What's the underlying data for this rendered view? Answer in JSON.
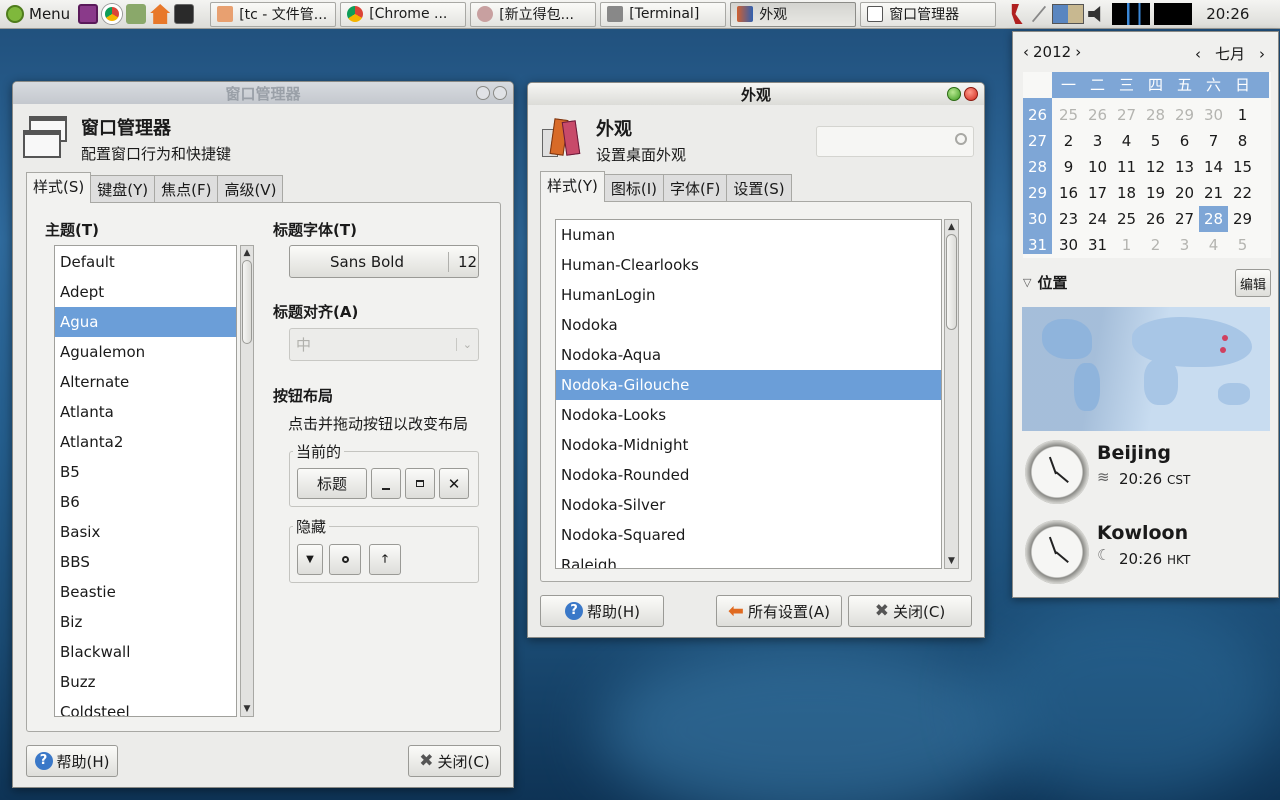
{
  "panel": {
    "menu_label": "Menu",
    "tasks": [
      {
        "label": "[tc - 文件管...",
        "icon": "home-folder-icon"
      },
      {
        "label": "[Chrome ...",
        "icon": "chrome-icon"
      },
      {
        "label": "[新立得包...",
        "icon": "synaptic-icon"
      },
      {
        "label": "[Terminal]",
        "icon": "terminal-icon"
      },
      {
        "label": "外观",
        "icon": "appearance-icon"
      },
      {
        "label": "窗口管理器",
        "icon": "window-manager-icon"
      }
    ],
    "clock": "20:26"
  },
  "wm_window": {
    "title": "窗口管理器",
    "header_title": "窗口管理器",
    "header_subtitle": "配置窗口行为和快捷键",
    "tabs": [
      "样式(S)",
      "键盘(Y)",
      "焦点(F)",
      "高级(V)"
    ],
    "theme_label": "主题(T)",
    "themes": [
      "Default",
      "Adept",
      "Agua",
      "Agualemon",
      "Alternate",
      "Atlanta",
      "Atlanta2",
      "B5",
      "B6",
      "Basix",
      "BBS",
      "Beastie",
      "Biz",
      "Blackwall",
      "Buzz",
      "Coldsteel"
    ],
    "selected_theme": "Agua",
    "title_font_label": "标题字体(T)",
    "title_font_name": "Sans Bold",
    "title_font_size": "12",
    "title_align_label": "标题对齐(A)",
    "title_align_value": "中",
    "button_layout_label": "按钮布局",
    "button_layout_hint": "点击并拖动按钮以改变布局",
    "current_label": "当前的",
    "title_button": "标题",
    "hidden_label": "隐藏",
    "help_button": "帮助(H)",
    "close_button": "关闭(C)"
  },
  "appearance_window": {
    "title": "外观",
    "header_title": "外观",
    "header_subtitle": "设置桌面外观",
    "search_placeholder": "",
    "tabs": [
      "样式(Y)",
      "图标(I)",
      "字体(F)",
      "设置(S)"
    ],
    "styles": [
      "Human",
      "Human-Clearlooks",
      "HumanLogin",
      "Nodoka",
      "Nodoka-Aqua",
      "Nodoka-Gilouche",
      "Nodoka-Looks",
      "Nodoka-Midnight",
      "Nodoka-Rounded",
      "Nodoka-Silver",
      "Nodoka-Squared",
      "Raleigh"
    ],
    "selected_style": "Nodoka-Gilouche",
    "help_button": "帮助(H)",
    "all_settings_button": "所有设置(A)",
    "close_button": "关闭(C)"
  },
  "calendar": {
    "year": "2012",
    "month": "七月",
    "weekdays": [
      "一",
      "二",
      "三",
      "四",
      "五",
      "六",
      "日"
    ],
    "weeks": [
      {
        "num": "26",
        "days": [
          "25",
          "26",
          "27",
          "28",
          "29",
          "30",
          "1"
        ]
      },
      {
        "num": "27",
        "days": [
          "2",
          "3",
          "4",
          "5",
          "6",
          "7",
          "8"
        ]
      },
      {
        "num": "28",
        "days": [
          "9",
          "10",
          "11",
          "12",
          "13",
          "14",
          "15"
        ]
      },
      {
        "num": "29",
        "days": [
          "16",
          "17",
          "18",
          "19",
          "20",
          "21",
          "22"
        ]
      },
      {
        "num": "30",
        "days": [
          "23",
          "24",
          "25",
          "26",
          "27",
          "28",
          "29"
        ]
      },
      {
        "num": "31",
        "days": [
          "30",
          "31",
          "1",
          "2",
          "3",
          "4",
          "5"
        ]
      }
    ],
    "today": "28",
    "locations_label": "位置",
    "edit_button": "编辑",
    "locations": [
      {
        "city": "Beijing",
        "time": "20:26",
        "tz": "CST",
        "weather_icon": "fog-icon"
      },
      {
        "city": "Kowloon",
        "time": "20:26",
        "tz": "HKT",
        "weather_icon": "night-cloud-icon"
      }
    ]
  },
  "colors": {
    "selection": "#6b9ed8",
    "calendar_accent": "#7ea6d6",
    "desktop": "#245d8c"
  }
}
